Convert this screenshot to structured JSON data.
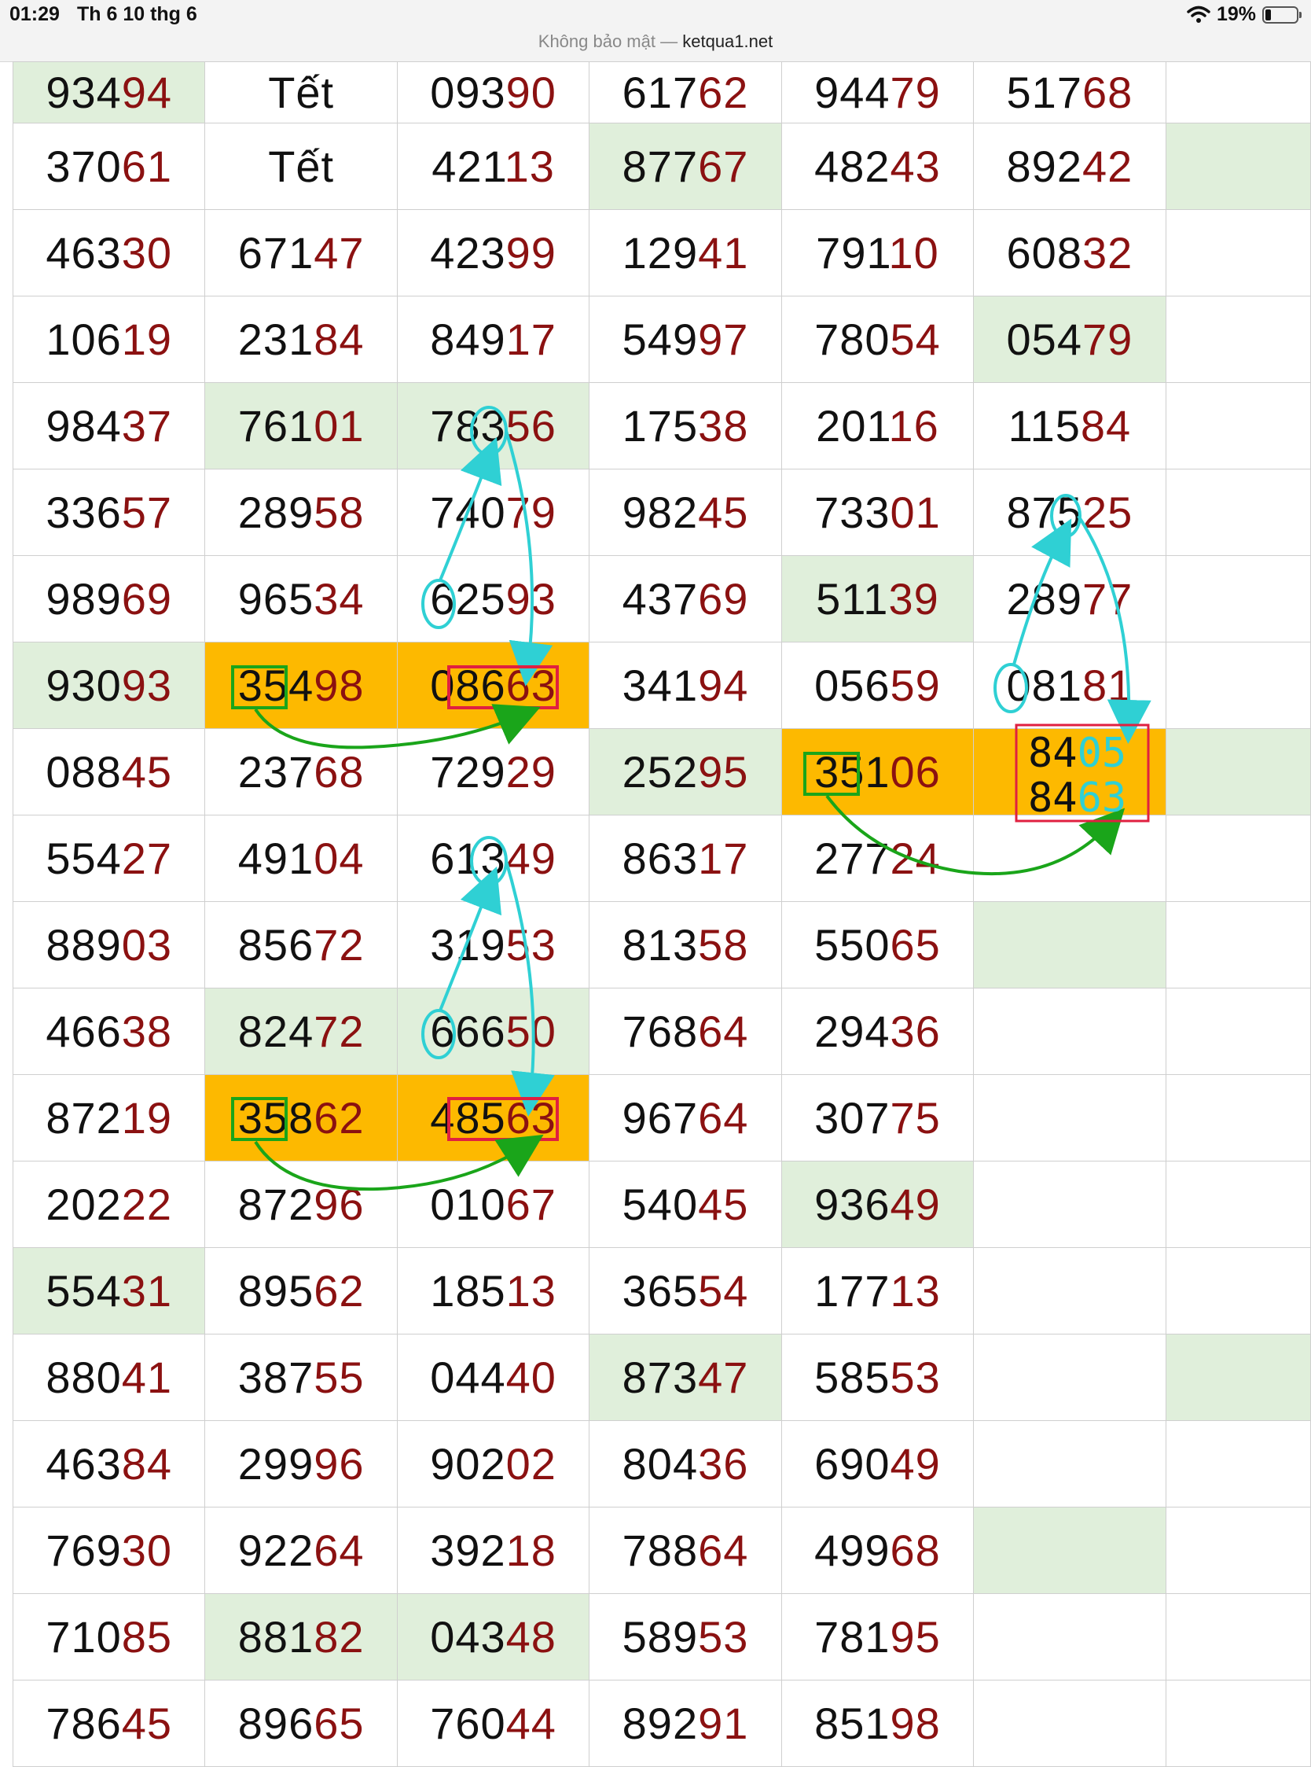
{
  "status_bar": {
    "time": "01:29",
    "date": "Th 6 10 thg 6",
    "battery": "19%",
    "security_label": "Không bảo mật —",
    "host": "ketqua1.net"
  },
  "colors": {
    "tail_digits": "#8b1111",
    "highlight_green": "#e0efdb",
    "highlight_orange": "#fdb900",
    "annotation_cyan": "#2fd0d4",
    "annotation_green": "#1aa51a",
    "annotation_red": "#e02040"
  },
  "rows": [
    [
      "93494",
      "Tết",
      "09390",
      "61762",
      "94479",
      "51768",
      ""
    ],
    [
      "37061",
      "Tết",
      "42113",
      "87767",
      "48243",
      "89242",
      ""
    ],
    [
      "46330",
      "67147",
      "42399",
      "12941",
      "79110",
      "60832",
      ""
    ],
    [
      "10619",
      "23184",
      "84917",
      "54997",
      "78054",
      "05479",
      ""
    ],
    [
      "98437",
      "76101",
      "78356",
      "17538",
      "20116",
      "11584",
      ""
    ],
    [
      "33657",
      "28958",
      "74079",
      "98245",
      "73301",
      "87525",
      ""
    ],
    [
      "98969",
      "96534",
      "62593",
      "43769",
      "51139",
      "28977",
      ""
    ],
    [
      "93093",
      "35498",
      "08663",
      "34194",
      "05659",
      "08181",
      ""
    ],
    [
      "08845",
      "23768",
      "72929",
      "25295",
      "35106",
      "",
      ""
    ],
    [
      "55427",
      "49104",
      "61349",
      "86317",
      "27724",
      "",
      ""
    ],
    [
      "88903",
      "85672",
      "31953",
      "81358",
      "55065",
      "",
      ""
    ],
    [
      "46638",
      "82472",
      "66650",
      "76864",
      "29436",
      "",
      ""
    ],
    [
      "87219",
      "35862",
      "48563",
      "96764",
      "30775",
      "",
      ""
    ],
    [
      "20222",
      "87296",
      "01067",
      "54045",
      "93649",
      "",
      ""
    ],
    [
      "55431",
      "89562",
      "18513",
      "36554",
      "17713",
      "",
      ""
    ],
    [
      "88041",
      "38755",
      "04440",
      "87347",
      "58553",
      "",
      ""
    ],
    [
      "46384",
      "29996",
      "90202",
      "80436",
      "69049",
      "",
      ""
    ],
    [
      "76930",
      "92264",
      "39218",
      "78864",
      "49968",
      "",
      ""
    ],
    [
      "71085",
      "88182",
      "04348",
      "58953",
      "78195",
      "",
      ""
    ],
    [
      "78645",
      "89665",
      "76044",
      "89291",
      "85198",
      "",
      ""
    ]
  ],
  "cell_highlights": [
    {
      "row": 0,
      "col": 0,
      "style": "green"
    },
    {
      "row": 1,
      "col": 3,
      "style": "green"
    },
    {
      "row": 1,
      "col": 6,
      "style": "green"
    },
    {
      "row": 3,
      "col": 5,
      "style": "green"
    },
    {
      "row": 4,
      "col": 1,
      "style": "green"
    },
    {
      "row": 4,
      "col": 2,
      "style": "green"
    },
    {
      "row": 6,
      "col": 4,
      "style": "green"
    },
    {
      "row": 7,
      "col": 0,
      "style": "green"
    },
    {
      "row": 7,
      "col": 1,
      "style": "orange"
    },
    {
      "row": 7,
      "col": 2,
      "style": "orange"
    },
    {
      "row": 8,
      "col": 3,
      "style": "green"
    },
    {
      "row": 8,
      "col": 4,
      "style": "orange"
    },
    {
      "row": 8,
      "col": 5,
      "style": "orange"
    },
    {
      "row": 8,
      "col": 6,
      "style": "green"
    },
    {
      "row": 10,
      "col": 5,
      "style": "green"
    },
    {
      "row": 11,
      "col": 1,
      "style": "green"
    },
    {
      "row": 11,
      "col": 2,
      "style": "green"
    },
    {
      "row": 12,
      "col": 1,
      "style": "orange"
    },
    {
      "row": 12,
      "col": 2,
      "style": "orange"
    },
    {
      "row": 13,
      "col": 4,
      "style": "green"
    },
    {
      "row": 14,
      "col": 0,
      "style": "green"
    },
    {
      "row": 15,
      "col": 3,
      "style": "green"
    },
    {
      "row": 15,
      "col": 6,
      "style": "green"
    },
    {
      "row": 17,
      "col": 5,
      "style": "green"
    },
    {
      "row": 18,
      "col": 1,
      "style": "green"
    },
    {
      "row": 18,
      "col": 2,
      "style": "green"
    }
  ],
  "handwritten": {
    "line1_prefix": "84",
    "line1_suffix": "05",
    "line2_prefix": "84",
    "line2_suffix": "63"
  }
}
